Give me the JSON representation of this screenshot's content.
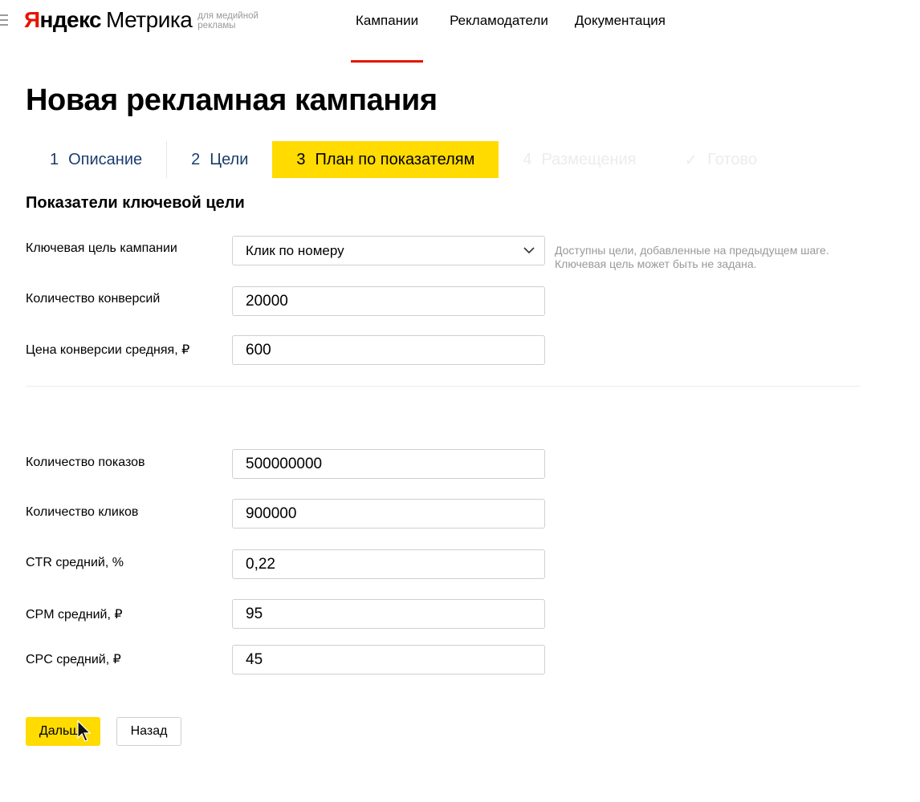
{
  "header": {
    "logo": {
      "yandex_first": "Я",
      "yandex_rest": "ндекс",
      "product": "Метрика",
      "subtitle_line1": "для медийной",
      "subtitle_line2": "рекламы"
    },
    "nav": [
      {
        "label": "Кампании",
        "active": true
      },
      {
        "label": "Рекламодатели",
        "active": false
      },
      {
        "label": "Документация",
        "active": false
      }
    ]
  },
  "page": {
    "title": "Новая рекламная кампания",
    "steps": [
      {
        "num": "1",
        "label": "Описание",
        "state": "done"
      },
      {
        "num": "2",
        "label": "Цели",
        "state": "done"
      },
      {
        "num": "3",
        "label": "План по показателям",
        "state": "current"
      },
      {
        "num": "4",
        "label": "Размещения",
        "state": "disabled"
      },
      {
        "num": "✓",
        "label": "Готово",
        "state": "disabled"
      }
    ]
  },
  "form": {
    "section_title": "Показатели ключевой цели",
    "key_goal": {
      "label": "Ключевая цель кампании",
      "value": "Клик по номеру"
    },
    "hint_line1": "Доступны цели, добавленные на предыдущем шаге.",
    "hint_line2": "Ключевая цель может быть не задана.",
    "conversions": {
      "label": "Количество конверсий",
      "value": "20000"
    },
    "conversion_price": {
      "label": "Цена конверсии средняя, ₽",
      "value": "600"
    },
    "impressions": {
      "label": "Количество показов",
      "value": "500000000"
    },
    "clicks": {
      "label": "Количество кликов",
      "value": "900000"
    },
    "ctr": {
      "label": "CTR средний, %",
      "value": "0,22"
    },
    "cpm": {
      "label": "CPM средний, ₽",
      "value": "95"
    },
    "cpc": {
      "label": "CPC средний, ₽",
      "value": "45"
    }
  },
  "buttons": {
    "next": "Дальше",
    "back": "Назад"
  },
  "colors": {
    "accent_yellow": "#ffdb00",
    "brand_red": "#e61400",
    "step_text": "#1a3d6e",
    "hint_gray": "#999999"
  }
}
